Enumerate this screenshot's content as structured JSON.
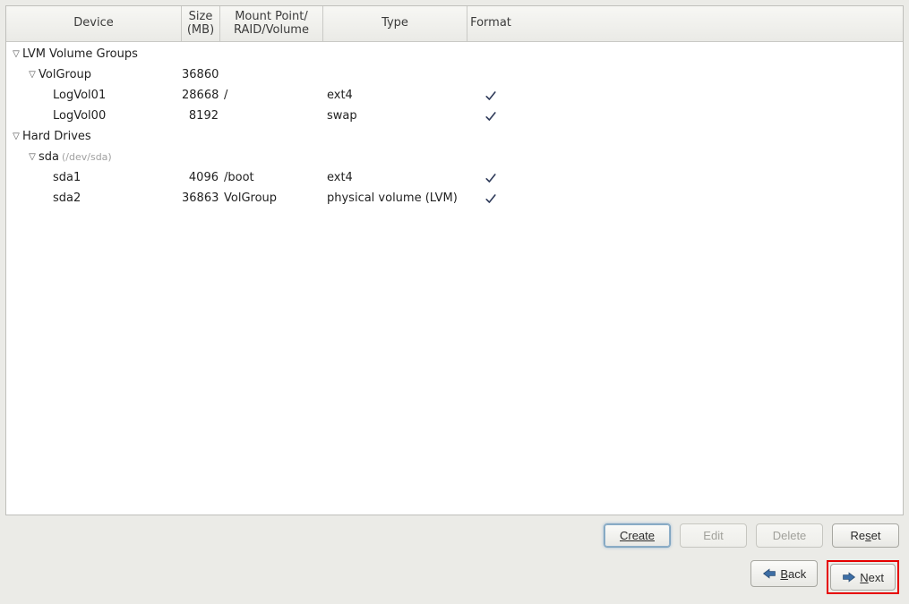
{
  "columns": {
    "device": "Device",
    "size": "Size\n(MB)",
    "mount": "Mount Point/\nRAID/Volume",
    "type": "Type",
    "format": "Format"
  },
  "tree": [
    {
      "kind": "group",
      "level": 0,
      "expanded": true,
      "label": "LVM Volume Groups"
    },
    {
      "kind": "group",
      "level": 1,
      "expanded": true,
      "label": "VolGroup",
      "size": "36860"
    },
    {
      "kind": "leaf",
      "level": 2,
      "label": "LogVol01",
      "size": "28668",
      "mount": "/",
      "type": "ext4",
      "format": true
    },
    {
      "kind": "leaf",
      "level": 2,
      "label": "LogVol00",
      "size": "8192",
      "mount": "",
      "type": "swap",
      "format": true
    },
    {
      "kind": "group",
      "level": 0,
      "expanded": true,
      "label": "Hard Drives"
    },
    {
      "kind": "group",
      "level": 1,
      "expanded": true,
      "label": "sda",
      "devpath": "(/dev/sda)"
    },
    {
      "kind": "leaf",
      "level": 2,
      "label": "sda1",
      "size": "4096",
      "mount": "/boot",
      "type": "ext4",
      "format": true
    },
    {
      "kind": "leaf",
      "level": 2,
      "label": "sda2",
      "size": "36863",
      "mount": "VolGroup",
      "type": "physical volume (LVM)",
      "format": true
    }
  ],
  "buttons": {
    "create": "Create",
    "edit": "Edit",
    "delete": "Delete",
    "reset": "Reset",
    "back": "Back",
    "next": "Next"
  }
}
